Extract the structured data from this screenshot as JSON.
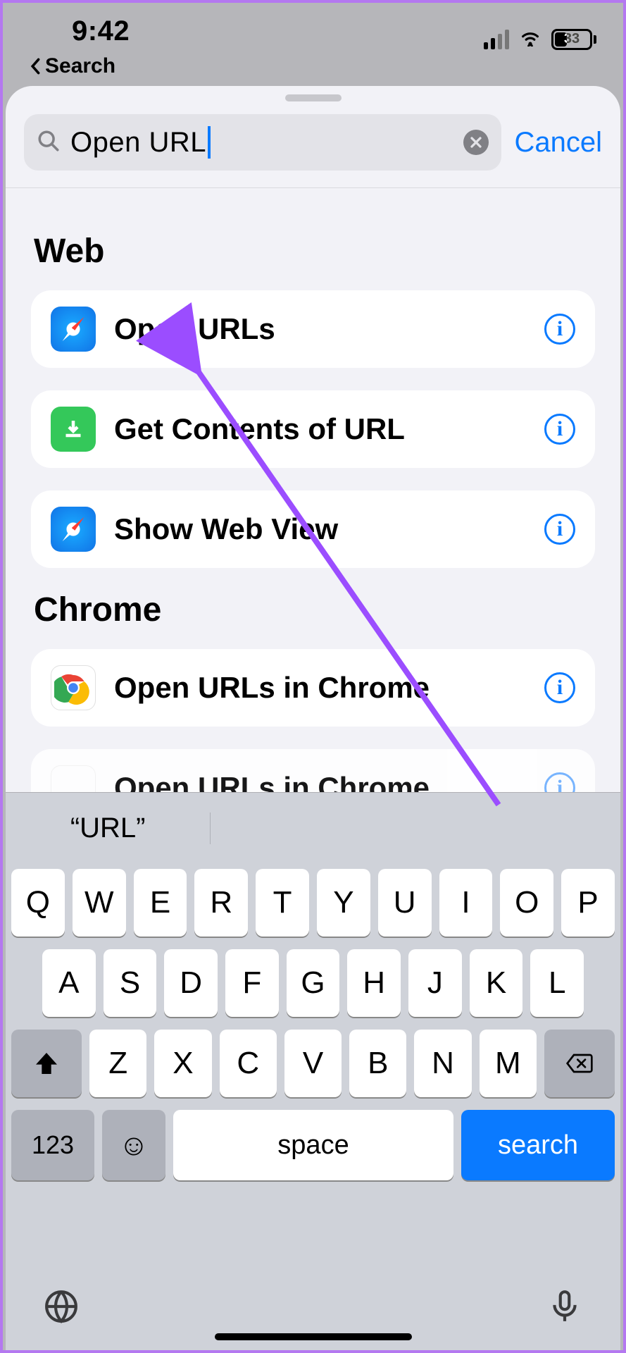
{
  "status": {
    "time": "9:42",
    "back_app": "Search",
    "battery_percent": "33"
  },
  "search": {
    "value": "Open URL",
    "cancel": "Cancel"
  },
  "sections": [
    {
      "title": "Web",
      "items": [
        {
          "icon": "safari",
          "label": "Open URLs"
        },
        {
          "icon": "download",
          "label": "Get Contents of URL"
        },
        {
          "icon": "safari",
          "label": "Show Web View"
        }
      ]
    },
    {
      "title": "Chrome",
      "items": [
        {
          "icon": "chrome",
          "label": "Open URLs in Chrome"
        },
        {
          "icon": "chrome",
          "label": "Open URLs in Chrome"
        }
      ]
    }
  ],
  "keyboard": {
    "suggestion": "“URL”",
    "row1": [
      "Q",
      "W",
      "E",
      "R",
      "T",
      "Y",
      "U",
      "I",
      "O",
      "P"
    ],
    "row2": [
      "A",
      "S",
      "D",
      "F",
      "G",
      "H",
      "J",
      "K",
      "L"
    ],
    "row3": [
      "Z",
      "X",
      "C",
      "V",
      "B",
      "N",
      "M"
    ],
    "k123": "123",
    "space": "space",
    "search": "search"
  }
}
